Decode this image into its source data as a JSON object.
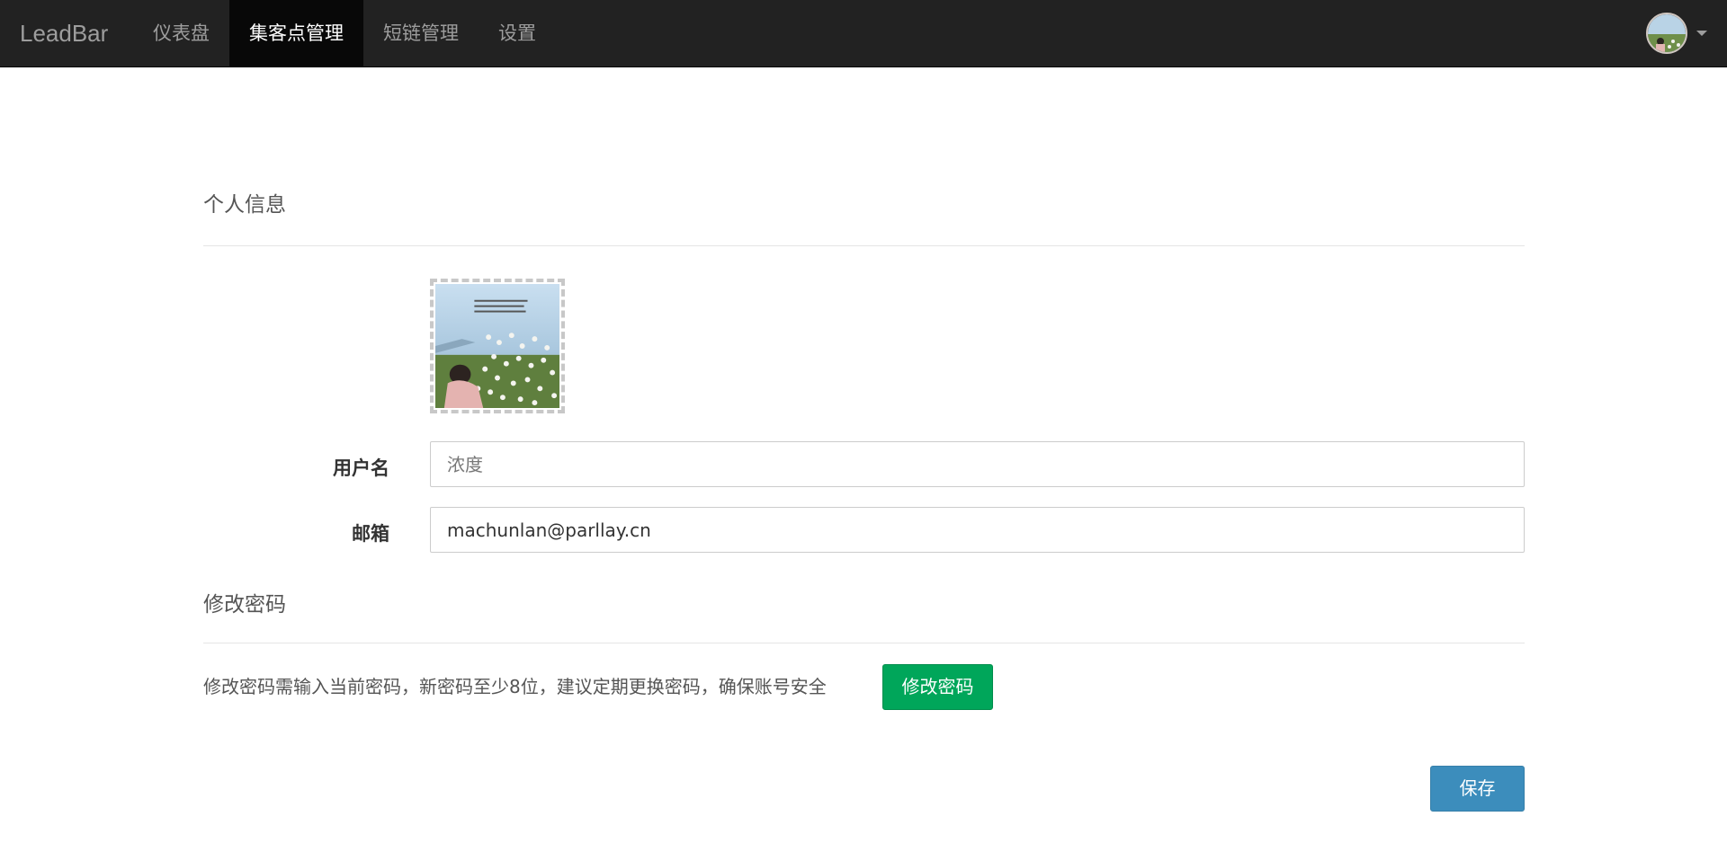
{
  "navbar": {
    "brand": "LeadBar",
    "items": [
      {
        "label": "仪表盘",
        "active": false
      },
      {
        "label": "集客点管理",
        "active": true
      },
      {
        "label": "短链管理",
        "active": false
      },
      {
        "label": "设置",
        "active": false
      }
    ],
    "user_menu_icon": "chevron-down-icon"
  },
  "profile": {
    "section_title": "个人信息",
    "username_label": "用户名",
    "username_placeholder": "浓度",
    "username_value": "",
    "email_label": "邮箱",
    "email_value": "machunlan@parllay.cn"
  },
  "password": {
    "section_title": "修改密码",
    "note": "修改密码需输入当前密码，新密码至少8位，建议定期更换密码，确保账号安全",
    "change_button": "修改密码"
  },
  "save_button": "保存",
  "colors": {
    "navbar_bg": "#222222",
    "nav_active_bg": "#080808",
    "success": "#00a65a",
    "primary": "#3c8dbc"
  }
}
